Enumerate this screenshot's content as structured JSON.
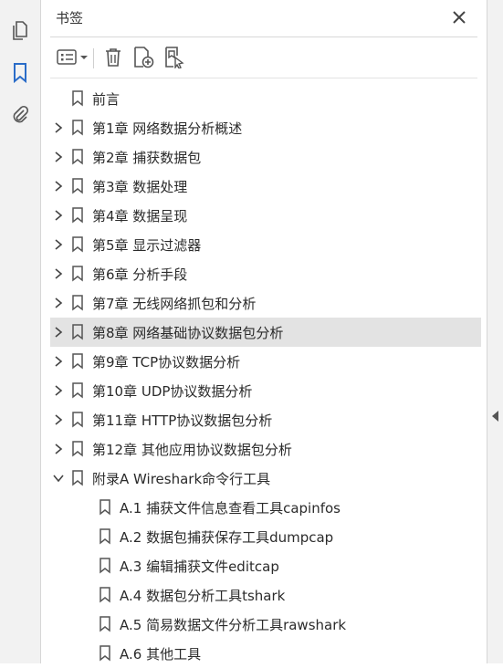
{
  "panel": {
    "title": "书签"
  },
  "rail": [
    {
      "name": "pages-icon"
    },
    {
      "name": "bookmarks-icon",
      "active": true
    },
    {
      "name": "attachments-icon"
    }
  ],
  "toolbar": [
    {
      "name": "options-menu-icon"
    },
    {
      "name": "delete-bookmark-icon"
    },
    {
      "name": "new-bookmark-icon"
    },
    {
      "name": "find-current-bookmark-icon"
    }
  ],
  "bookmarks": [
    {
      "label": "前言",
      "level": 0,
      "expandable": false
    },
    {
      "label": "第1章 网络数据分析概述",
      "level": 0,
      "expandable": true
    },
    {
      "label": "第2章 捕获数据包",
      "level": 0,
      "expandable": true
    },
    {
      "label": "第3章 数据处理",
      "level": 0,
      "expandable": true
    },
    {
      "label": "第4章 数据呈现",
      "level": 0,
      "expandable": true
    },
    {
      "label": "第5章 显示过滤器",
      "level": 0,
      "expandable": true
    },
    {
      "label": "第6章 分析手段",
      "level": 0,
      "expandable": true
    },
    {
      "label": "第7章 无线网络抓包和分析",
      "level": 0,
      "expandable": true
    },
    {
      "label": "第8章 网络基础协议数据包分析",
      "level": 0,
      "expandable": true,
      "selected": true
    },
    {
      "label": "第9章 TCP协议数据分析",
      "level": 0,
      "expandable": true
    },
    {
      "label": "第10章 UDP协议数据分析",
      "level": 0,
      "expandable": true
    },
    {
      "label": "第11章 HTTP协议数据包分析",
      "level": 0,
      "expandable": true
    },
    {
      "label": "第12章 其他应用协议数据包分析",
      "level": 0,
      "expandable": true
    },
    {
      "label": "附录A Wireshark命令行工具",
      "level": 0,
      "expandable": true,
      "expanded": true
    },
    {
      "label": "A.1 捕获文件信息查看工具capinfos",
      "level": 1,
      "expandable": false
    },
    {
      "label": "A.2 数据包捕获保存工具dumpcap",
      "level": 1,
      "expandable": false
    },
    {
      "label": "A.3 编辑捕获文件editcap",
      "level": 1,
      "expandable": false
    },
    {
      "label": "A.4 数据包分析工具tshark",
      "level": 1,
      "expandable": false
    },
    {
      "label": "A.5 简易数据文件分析工具rawshark",
      "level": 1,
      "expandable": false
    },
    {
      "label": "A.6 其他工具",
      "level": 1,
      "expandable": false
    }
  ]
}
